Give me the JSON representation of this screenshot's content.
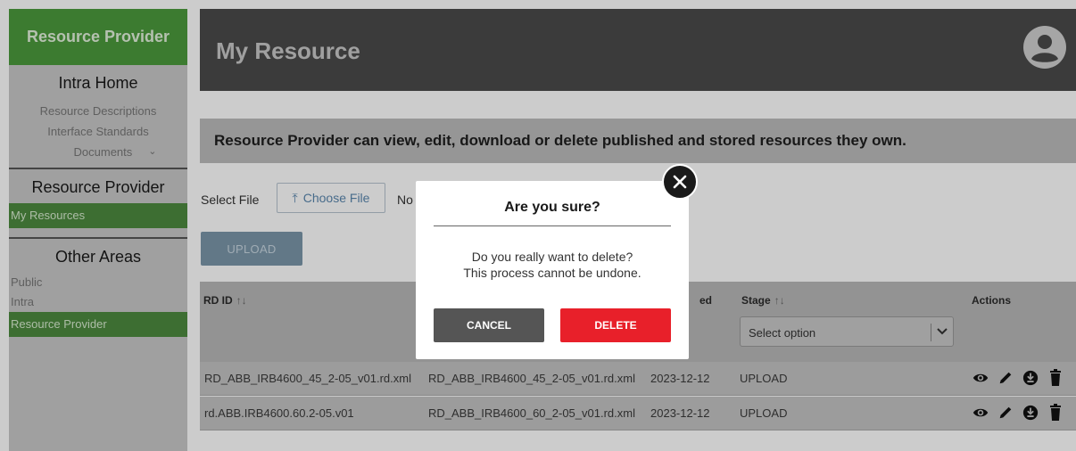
{
  "sidebar": {
    "brand": "Resource Provider",
    "intra_home": "Intra Home",
    "links": [
      "Resource Descriptions",
      "Interface Standards"
    ],
    "documents": "Documents",
    "rp_heading": "Resource Provider",
    "active_item": "My Resources",
    "other_areas": "Other Areas",
    "other_items": [
      "Public",
      "Intra"
    ],
    "other_active": "Resource Provider"
  },
  "header": {
    "title": "My Resource",
    "avatar_icon": "account-circle-icon"
  },
  "banner": {
    "text": "Resource Provider can view, edit, download or delete published and stored resources they own."
  },
  "upload": {
    "select_label": "Select File",
    "choose_label": "Choose File",
    "no_file": "No",
    "upload_label": "UPLOAD"
  },
  "table": {
    "headers": {
      "rd_id": "RD ID",
      "sort": "↑↓",
      "created_partial": "ed",
      "stage": "Stage",
      "actions": "Actions"
    },
    "stage_placeholder": "Select option",
    "rows": [
      {
        "rd_id": "RD_ABB_IRB4600_45_2-05_v01.rd.xml",
        "file": "RD_ABB_IRB4600_45_2-05_v01.rd.xml",
        "date": "2023-12-12",
        "stage": "UPLOAD"
      },
      {
        "rd_id": "rd.ABB.IRB4600.60.2-05.v01",
        "file": "RD_ABB_IRB4600_60_2-05_v01.rd.xml",
        "date": "2023-12-12",
        "stage": "UPLOAD"
      }
    ],
    "action_icons": [
      "eye-icon",
      "pencil-icon",
      "download-circle-icon",
      "trash-icon"
    ]
  },
  "modal": {
    "title": "Are you sure?",
    "line1": "Do you really want to delete?",
    "line2": "This process cannot be undone.",
    "cancel": "CANCEL",
    "delete": "DELETE"
  },
  "colors": {
    "brand_green": "#4c9a3c",
    "header_dark": "#4a4a4a",
    "delete_red": "#e8202a"
  }
}
